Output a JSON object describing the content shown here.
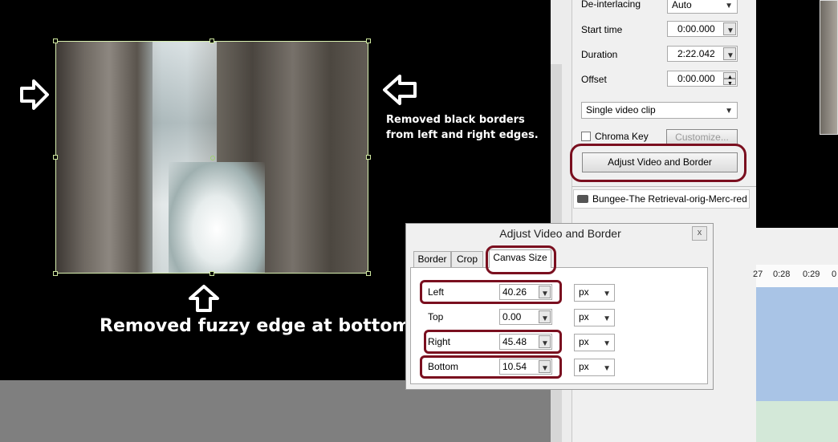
{
  "panel": {
    "deinterlacing_label": "De-interlacing",
    "deinterlacing_value": "Auto",
    "start_time_label": "Start time",
    "start_time_value": "0:00.000",
    "duration_label": "Duration",
    "duration_value": "2:22.042",
    "offset_label": "Offset",
    "offset_value": "0:00.000",
    "clip_mode_value": "Single video clip",
    "chroma_key_label": "Chroma Key",
    "customize_label": "Customize...",
    "adjust_button_label": "Adjust Video and Border",
    "media_item_label": "Bungee-The Retrieval-orig-Merc-red"
  },
  "captions": {
    "side_line1": "Removed black borders",
    "side_line2": "from left and right edges.",
    "bottom": "Removed fuzzy edge at bottom"
  },
  "dialog": {
    "title": "Adjust Video and Border",
    "close_label": "x",
    "tabs": [
      "Border",
      "Crop",
      "Canvas Size"
    ],
    "rows": [
      {
        "label": "Left",
        "value": "40.26",
        "unit": "px"
      },
      {
        "label": "Top",
        "value": "0.00",
        "unit": "px"
      },
      {
        "label": "Right",
        "value": "45.48",
        "unit": "px"
      },
      {
        "label": "Bottom",
        "value": "10.54",
        "unit": "px"
      }
    ]
  },
  "timeline": {
    "ticks": [
      "27",
      "0:28",
      "0:29",
      "0"
    ]
  },
  "colors": {
    "highlight": "#7a0f1f",
    "timeline_track": "#a9c4e6"
  }
}
